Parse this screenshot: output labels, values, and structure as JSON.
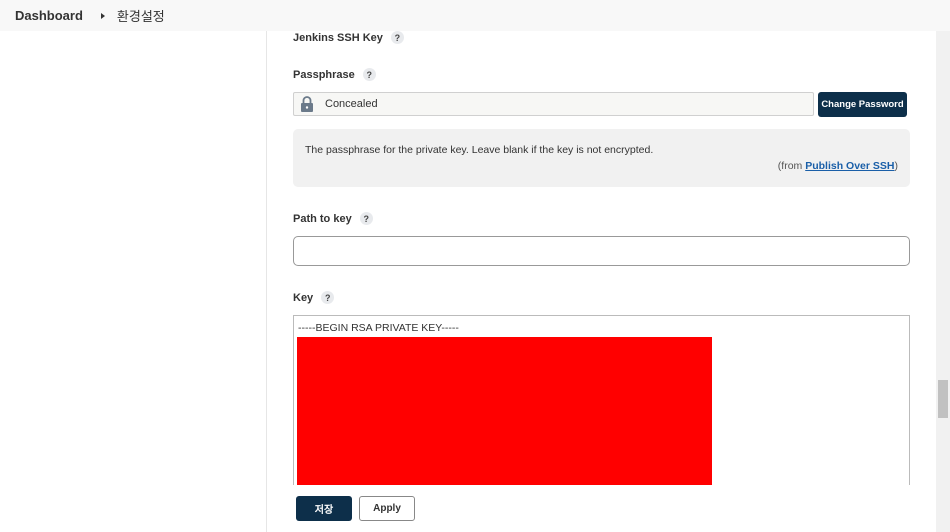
{
  "breadcrumb": {
    "dashboard": "Dashboard",
    "current": "환경설정"
  },
  "form": {
    "jenkins_ssh_key_label": "Jenkins SSH Key",
    "passphrase_label": "Passphrase",
    "passphrase_value": "Concealed",
    "change_password_label": "Change Password",
    "passphrase_help": "The passphrase for the private key. Leave blank if the key is not encrypted.",
    "help_from_prefix": "(from ",
    "help_from_link": "Publish Over SSH",
    "help_from_suffix": ")",
    "path_to_key_label": "Path to key",
    "path_to_key_value": "",
    "key_label": "Key",
    "key_begin": "-----BEGIN RSA PRIVATE KEY-----",
    "help_symbol": "?"
  },
  "actions": {
    "save_label": "저장",
    "apply_label": "Apply"
  },
  "colors": {
    "primary_button": "#0d2f4a",
    "redaction": "#ff0000",
    "link": "#1a5fa8"
  },
  "icons": {
    "breadcrumb_separator": "caret-right-icon",
    "passphrase_lock": "lock-icon",
    "help": "help-icon"
  }
}
